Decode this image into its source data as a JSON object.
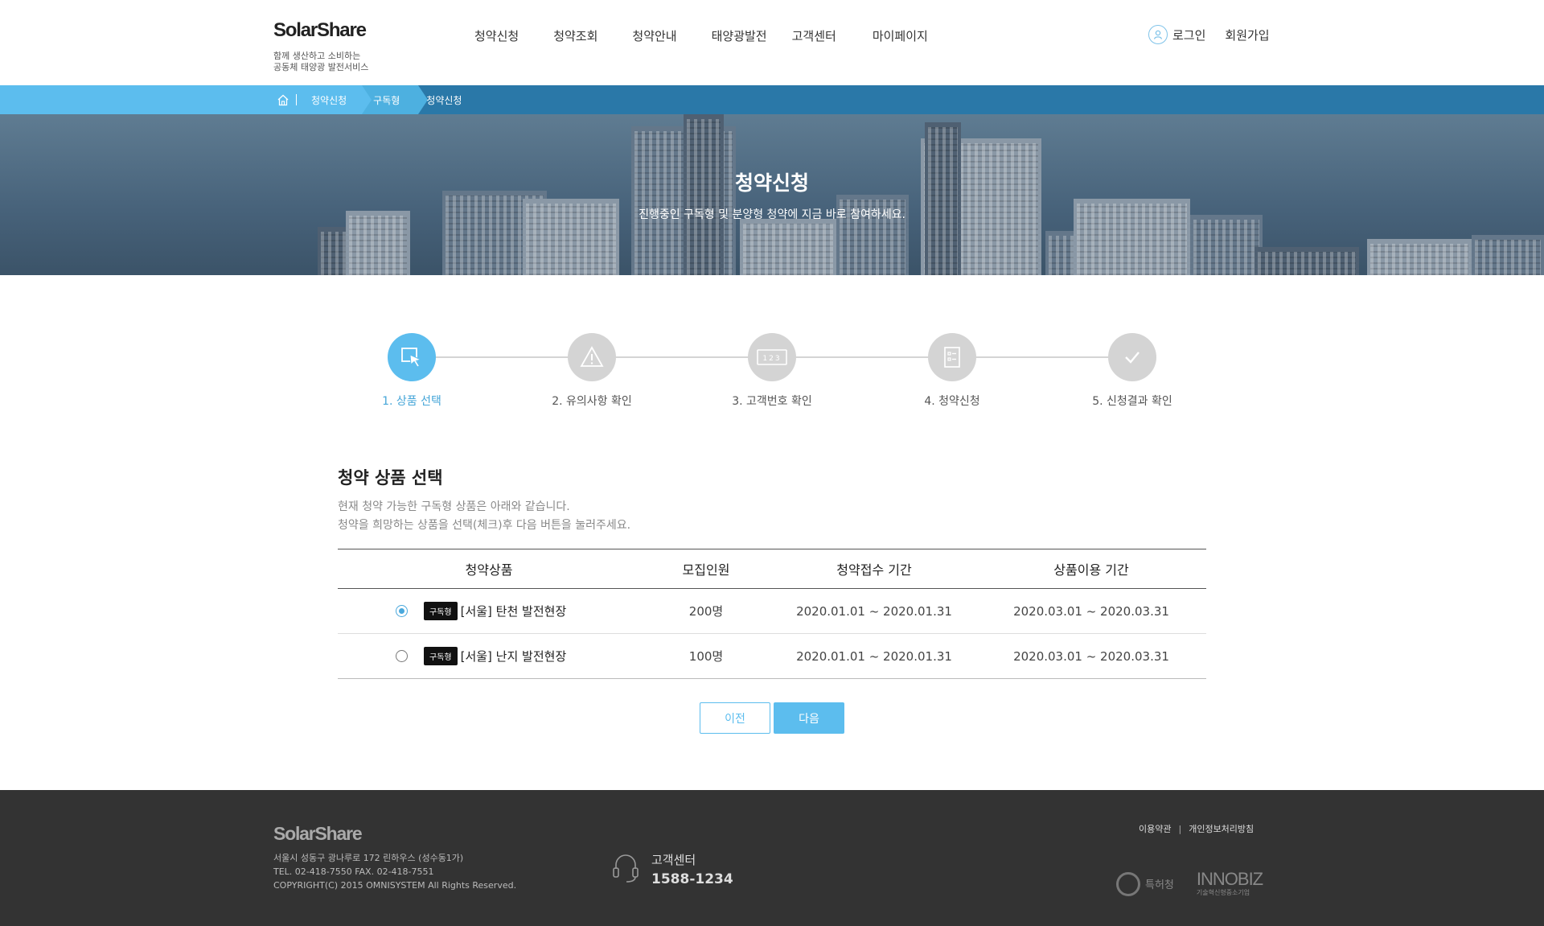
{
  "header": {
    "logo": "SolarShare",
    "tagline": [
      "함께 생산하고 소비하는",
      "공동체 태양광 발전서비스"
    ],
    "nav": [
      "청약신청",
      "청약조회",
      "청약안내",
      "태양광발전",
      "고객센터",
      "마이페이지"
    ],
    "login": "로그인",
    "signup": "회원가입"
  },
  "breadcrumb": {
    "items": [
      "청약신청",
      "구독형",
      "청약신청"
    ],
    "colors": {
      "level1": "#5cbdee",
      "level2": "#4db0e0",
      "bar": "#2a78a8"
    }
  },
  "hero": {
    "title": "청약신청",
    "subtitle": "진행중인 구독형 및 분양형 청약에 지금 바로 참여하세요."
  },
  "steps": [
    {
      "label": "1. 상품 선택",
      "icon": "cursor-click-icon",
      "active": true
    },
    {
      "label": "2. 유의사항 확인",
      "icon": "warning-icon",
      "active": false
    },
    {
      "label": "3. 고객번호 확인",
      "icon": "number-card-icon",
      "active": false
    },
    {
      "label": "4. 청약신청",
      "icon": "form-icon",
      "active": false
    },
    {
      "label": "5. 신청결과 확인",
      "icon": "checkmark-icon",
      "active": false
    }
  ],
  "section": {
    "title": "청약 상품 선택",
    "desc": [
      "현재 청약 가능한 구독형 상품은 아래와 같습니다.",
      "청약을 희망하는 상품을 선택(체크)후 다음 버튼을 눌러주세요."
    ]
  },
  "table": {
    "headers": [
      "청약상품",
      "모집인원",
      "청약접수 기간",
      "상품이용 기간"
    ],
    "rows": [
      {
        "checked": true,
        "badge": "구독형",
        "name": "[서울] 탄천 발전현장",
        "recruit": "200명",
        "apply": "2020.01.01 ~ 2020.01.31",
        "use": "2020.03.01 ~ 2020.03.31"
      },
      {
        "checked": false,
        "badge": "구독형",
        "name": "[서울] 난지 발전현장",
        "recruit": "100명",
        "apply": "2020.01.01 ~ 2020.01.31",
        "use": "2020.03.01 ~ 2020.03.31"
      }
    ]
  },
  "buttons": {
    "prev": "이전",
    "next": "다음"
  },
  "footer": {
    "logo": "SolarShare",
    "address": [
      "서울시 성동구 광나루로 172 린하우스 (성수동1가)",
      "TEL. 02-418-7550  FAX. 02-418-7551",
      "COPYRIGHT(C) 2015 OMNISYSTEM All Rights Reserved."
    ],
    "cs_label": "고객센터",
    "cs_number": "1588-1234",
    "links": [
      "이용약관",
      "개인정보처리방침"
    ],
    "cert1": "특허청",
    "cert2_main": "INNOBIZ",
    "cert2_sub": "기술혁신형중소기업"
  },
  "colors": {
    "accent": "#5cbdee",
    "accent_text": "#46a6d8",
    "inactive": "#d4d4d4",
    "footer_bg": "#333333"
  }
}
